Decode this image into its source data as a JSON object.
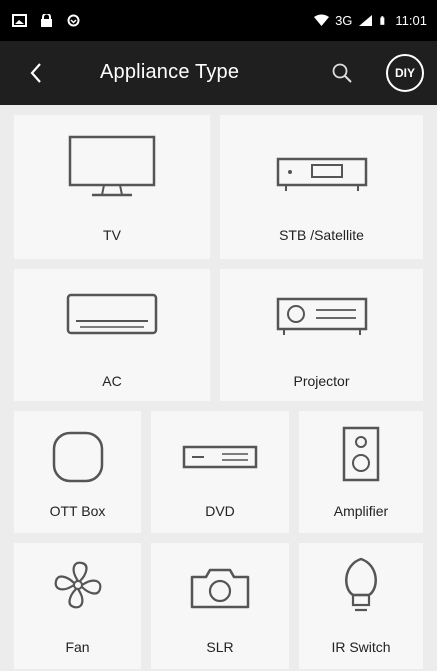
{
  "status_bar": {
    "network": "3G",
    "time": "11:01"
  },
  "app_bar": {
    "title": "Appliance Type",
    "diy_label": "DIY"
  },
  "appliances": [
    {
      "label": "TV",
      "icon": "tv-icon"
    },
    {
      "label": "STB /Satellite",
      "icon": "set-top-box-icon"
    },
    {
      "label": "AC",
      "icon": "air-conditioner-icon"
    },
    {
      "label": "Projector",
      "icon": "projector-icon"
    },
    {
      "label": "OTT Box",
      "icon": "ott-box-icon"
    },
    {
      "label": "DVD",
      "icon": "dvd-player-icon"
    },
    {
      "label": "Amplifier",
      "icon": "speaker-icon"
    },
    {
      "label": "Fan",
      "icon": "fan-icon"
    },
    {
      "label": "SLR",
      "icon": "camera-icon"
    },
    {
      "label": "IR Switch",
      "icon": "light-bulb-icon"
    }
  ],
  "colors": {
    "status_bar": "#000000",
    "app_bar": "#1f1f1f",
    "background": "#ececec",
    "tile": "#f7f7f7",
    "icon_stroke": "#555555"
  }
}
